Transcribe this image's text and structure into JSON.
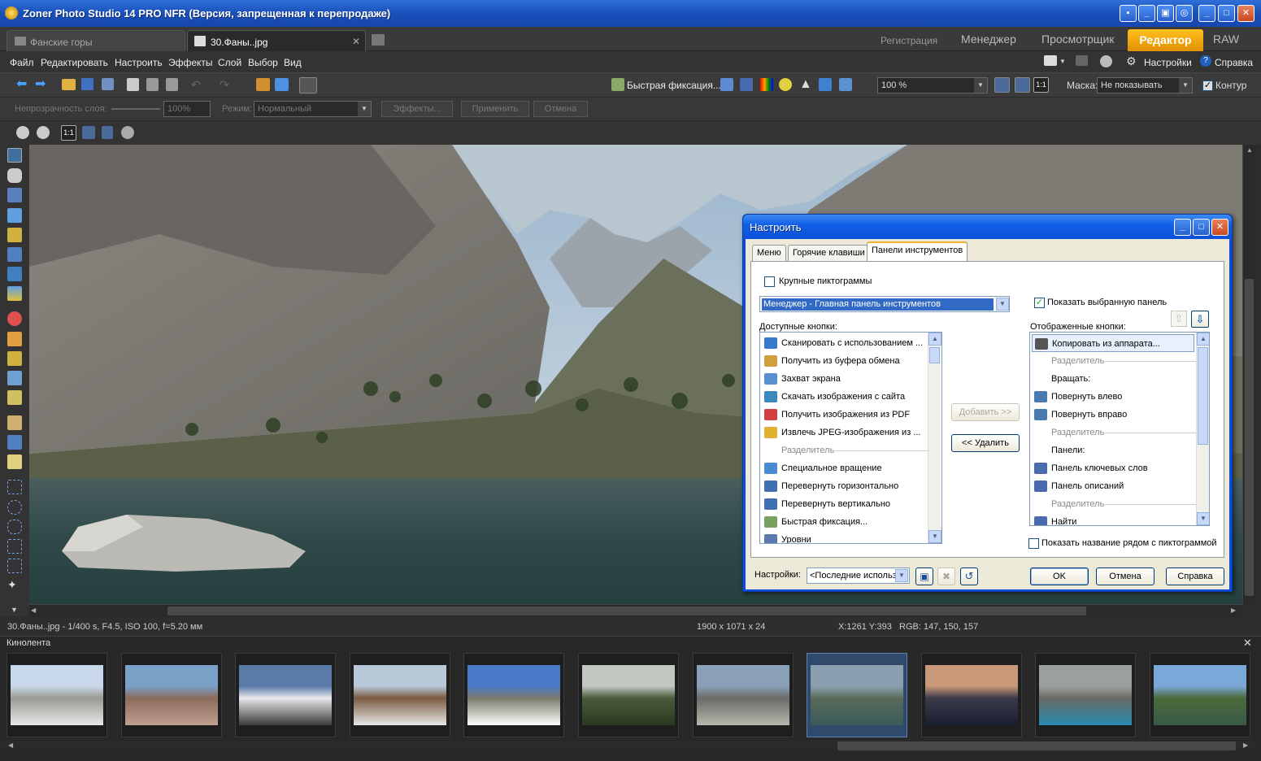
{
  "window": {
    "title": "Zoner Photo Studio 14 PRO NFR (Версия, запрещенная к перепродаже)",
    "buttons": [
      "pin",
      "minimize-small",
      "palette",
      "maximize-small",
      "minimize",
      "maximize",
      "close"
    ]
  },
  "tabs": {
    "docs": [
      {
        "label": "Фанские горы",
        "active": false
      },
      {
        "label": "30.Фаны..jpg",
        "active": true
      }
    ],
    "modes": [
      {
        "label": "Регистрация"
      },
      {
        "label": "Менеджер"
      },
      {
        "label": "Просмотрщик"
      },
      {
        "label": "Редактор",
        "active": true
      },
      {
        "label": "RAW"
      }
    ],
    "accent": "#f0a800"
  },
  "menu": {
    "items": [
      "Файл",
      "Редактировать",
      "Настроить",
      "Эффекты",
      "Слой",
      "Выбор",
      "Вид"
    ],
    "right": {
      "settings": "Настройки",
      "help": "Справка"
    }
  },
  "toolbar": {
    "quick_fix": "Быстрая фиксация...",
    "zoom": "100 %",
    "mask_label": "Маска:",
    "mask_value": "Не показывать",
    "contour": "Контур"
  },
  "layer_bar": {
    "opacity_label": "Непрозрачность слоя:",
    "opacity_value": "100%",
    "mode_label": "Режим:",
    "mode_value": "Нормальный",
    "effects": "Эффекты...",
    "apply": "Применить",
    "cancel": "Отмена"
  },
  "status": {
    "file": "30.Фаны..jpg - 1/400 s, F4.5, ISO 100, f=5.20 мм",
    "dims": "1900 x 1071 x 24",
    "coords": "X:1261 Y:393",
    "rgb": "RGB: 147, 150, 157"
  },
  "filmstrip": {
    "title": "Кинолента",
    "count": 11,
    "selected": 8
  },
  "dialog": {
    "title": "Настроить",
    "tabs": [
      "Меню",
      "Горячие клавиши",
      "Панели инструментов"
    ],
    "large_icons": "Крупные пиктограммы",
    "panel_select": "Менеджер - Главная панель инструментов",
    "show_selected_panel": "Показать выбранную панель",
    "available_label": "Доступные кнопки:",
    "displayed_label": "Отображенные кнопки:",
    "available": [
      {
        "label": "Сканировать с использованием ...",
        "icon": "scanner-icon"
      },
      {
        "label": "Получить из буфера обмена",
        "icon": "clipboard-icon"
      },
      {
        "label": "Захват экрана",
        "icon": "screen-icon"
      },
      {
        "label": "Скачать изображения с сайта",
        "icon": "web-icon"
      },
      {
        "label": "Получить изображения из PDF",
        "icon": "pdf-icon"
      },
      {
        "label": "Извлечь JPEG-изображения из ...",
        "icon": "extract-icon"
      },
      {
        "label": "Разделитель",
        "sep": true
      },
      {
        "label": "Специальное вращение",
        "icon": "rotate-icon"
      },
      {
        "label": "Перевернуть горизонтально",
        "icon": "flip-h-icon"
      },
      {
        "label": "Перевернуть вертикально",
        "icon": "flip-v-icon"
      },
      {
        "label": "Быстрая фиксация...",
        "icon": "quickfix-icon"
      },
      {
        "label": "Уровни",
        "icon": "levels-icon"
      }
    ],
    "displayed": [
      {
        "label": "Копировать из аппарата...",
        "icon": "camera-icon",
        "selected": true
      },
      {
        "label": "Разделитель",
        "sep": true
      },
      {
        "label": "Вращать:"
      },
      {
        "label": "Повернуть влево",
        "icon": "rotate-left-icon"
      },
      {
        "label": "Повернуть вправо",
        "icon": "rotate-right-icon"
      },
      {
        "label": "Разделитель",
        "sep": true
      },
      {
        "label": "Панели:"
      },
      {
        "label": "Панель ключевых слов",
        "icon": "keywords-icon"
      },
      {
        "label": "Панель описаний",
        "icon": "description-icon"
      },
      {
        "label": "Разделитель",
        "sep": true
      },
      {
        "label": "Найти",
        "icon": "find-icon"
      }
    ],
    "add": "Добавить >>",
    "remove": "<< Удалить",
    "show_names": "Показать название рядом с пиктограммой",
    "settings_label": "Настройки:",
    "settings_value": "<Последние использ",
    "ok": "OK",
    "cancel": "Отмена",
    "help": "Справка"
  }
}
